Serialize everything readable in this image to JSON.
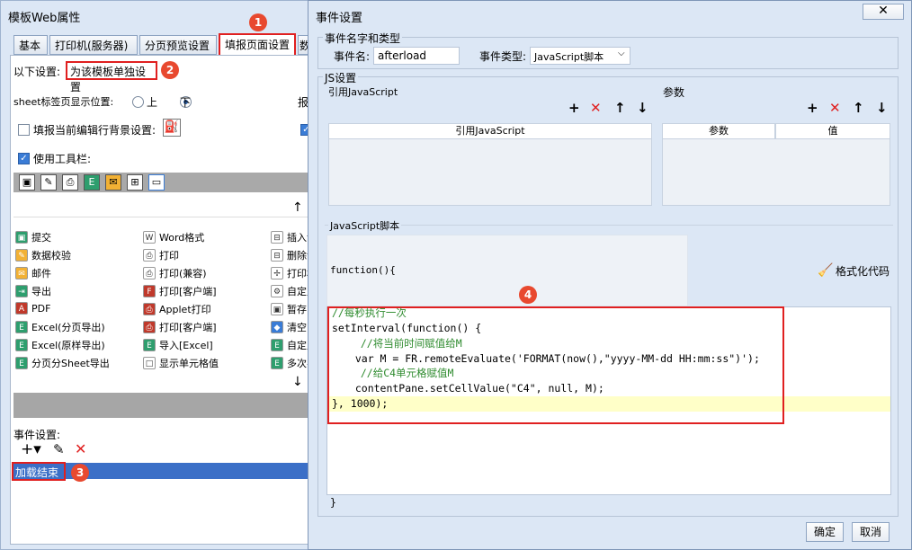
{
  "left_window": {
    "title": "模板Web属性",
    "tabs": [
      "基本",
      "打印机(服务器)",
      "分页预览设置",
      "填报页面设置",
      "数"
    ],
    "setting_label": "以下设置:",
    "setting_value": "为该模板单独设置",
    "sheet_pos_label": "sheet标签页显示位置:",
    "radio_top": "上",
    "radio_bottom": "下",
    "cut_label": "报",
    "bg_label": "填报当前编辑行背景设置:",
    "toolbar_label": "使用工具栏:",
    "grid": [
      [
        "提交",
        "Word格式",
        "插入记录"
      ],
      [
        "数据校验",
        "打印",
        "删除记录"
      ],
      [
        "邮件",
        "打印(兼容)",
        "打印机机"
      ],
      [
        "导出",
        "打印[客户端]",
        "自定义按"
      ],
      [
        "PDF",
        "Applet打印",
        "暂存"
      ],
      [
        "Excel(分页导出)",
        "打印[客户端]",
        "清空"
      ],
      [
        "Excel(原样导出)",
        "导入[Excel]",
        "自定义按"
      ],
      [
        "分页分Sheet导出",
        "显示单元格值",
        "多次导入"
      ]
    ],
    "event_label": "事件设置:",
    "event_item": "加载结束",
    "badges": [
      "1",
      "2",
      "3"
    ]
  },
  "right_window": {
    "title": "事件设置",
    "group_event": "事件名字和类型",
    "event_name_label": "事件名:",
    "event_name_value": "afterload",
    "event_type_label": "事件类型:",
    "event_type_value": "JavaScript脚本",
    "group_js": "JS设置",
    "ref_js_label": "引用JavaScript",
    "params_label": "参数",
    "ref_js_col": "引用JavaScript",
    "param_col": "参数",
    "value_col": "值",
    "script_label": "JavaScript脚本",
    "func_open": "function(){",
    "format_label": "格式化代码",
    "badge4": "4",
    "code_lines": [
      "//每秒执行一次",
      "setInterval(function() {",
      "  //将当前时间赋值给M",
      "  var M = FR.remoteEvaluate('FORMAT(now(),\"yyyy-MM-dd HH:mm:ss\")');",
      "  //给C4单元格赋值M",
      "  contentPane.setCellValue(\"C4\", null, M);",
      "}, 1000);"
    ],
    "func_close": "}",
    "ok": "确定",
    "cancel": "取消"
  },
  "colors": {
    "accent": "#e02020",
    "selected": "#3b6fc7",
    "highlight_line": "#ffffc8"
  }
}
